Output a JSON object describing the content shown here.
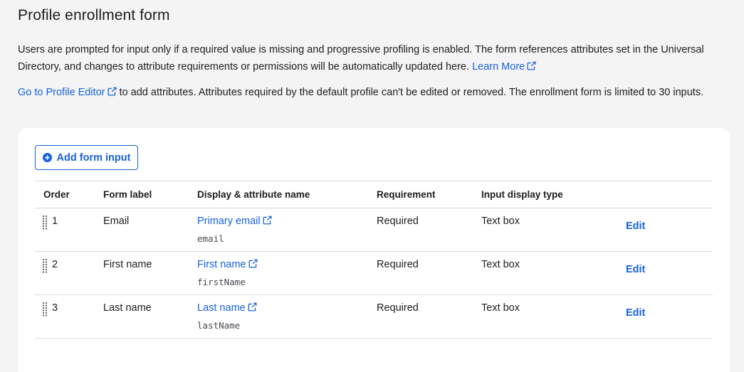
{
  "page": {
    "title": "Profile enrollment form",
    "description": "Users are prompted for input only if a required value is missing and progressive profiling is enabled. The form references attributes set in the Universal Directory, and changes to attribute requirements or permissions will be automatically updated here.",
    "learn_more": "Learn More",
    "profile_editor_link": "Go to Profile Editor",
    "profile_editor_text": "to add attributes. Attributes required by the default profile can't be edited or removed. The enrollment form is limited to 30 inputs."
  },
  "toolbar": {
    "add_label": "Add form input"
  },
  "table": {
    "headers": {
      "order": "Order",
      "label": "Form label",
      "attr": "Display & attribute name",
      "req": "Requirement",
      "type": "Input display type"
    },
    "rows": [
      {
        "order": "1",
        "label": "Email",
        "display": "Primary email",
        "attr": "email",
        "req": "Required",
        "type": "Text box",
        "edit": "Edit"
      },
      {
        "order": "2",
        "label": "First name",
        "display": "First name",
        "attr": "firstName",
        "req": "Required",
        "type": "Text box",
        "edit": "Edit"
      },
      {
        "order": "3",
        "label": "Last name",
        "display": "Last name",
        "attr": "lastName",
        "req": "Required",
        "type": "Text box",
        "edit": "Edit"
      }
    ]
  },
  "icons": {
    "external": "external-link-icon",
    "plus": "plus-circle-icon",
    "drag": "drag-handle-icon"
  },
  "colors": {
    "link": "#1662dd",
    "background": "#f4f4f4",
    "card": "#ffffff"
  }
}
